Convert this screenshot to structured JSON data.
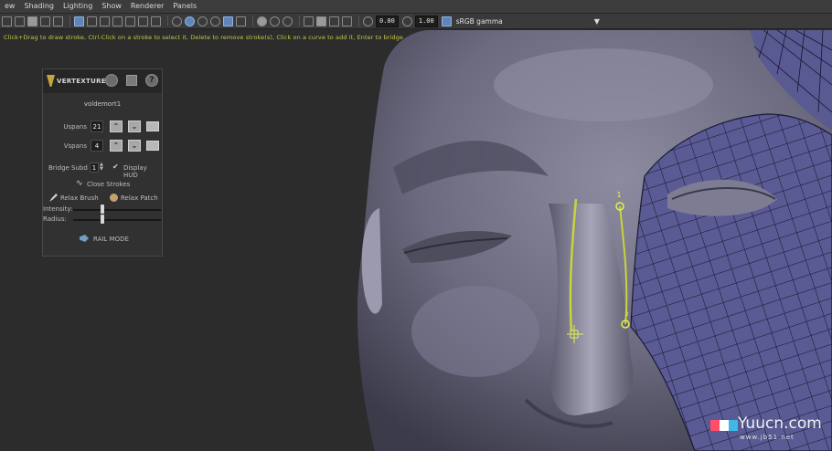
{
  "menu": [
    "ew",
    "Shading",
    "Lighting",
    "Show",
    "Renderer",
    "Panels"
  ],
  "toolbar": {
    "field_a": "0.00",
    "field_b": "1.00",
    "colorspace": "sRGB gamma",
    "dropdown_icon": "chevron-down-icon"
  },
  "hud_line": "Click+Drag to draw stroke, Ctrl-Click on a stroke to select it, Delete to remove stroke(s), Click on a curve to add it, Enter to bridge",
  "panel": {
    "title": "VERTEXTURE",
    "mesh_name": "voldemort1",
    "uspans_label": "Uspans",
    "uspans_value": "21",
    "vspans_label": "Vspans",
    "vspans_value": "4",
    "bridge_label": "Bridge Subd",
    "bridge_value": "1",
    "display_hud_label": "Display HUD",
    "close_strokes_label": "Close Strokes",
    "relax_brush_label": "Relax Brush",
    "relax_patch_label": "Relax Patch",
    "intensity_label": "Intensity:",
    "radius_label": "Radius:",
    "rail_mode_label": "RAIL MODE",
    "intensity_level": 0.33,
    "radius_level": 0.33
  },
  "viewport": {
    "stroke_label_1": "1",
    "stroke_label_2": "2"
  },
  "watermark": {
    "text": "Yuucn.com",
    "sub": "www.jb51.net",
    "colors": [
      "#ff4d6a",
      "#ffffff",
      "#3fb8e8"
    ]
  },
  "colors": {
    "skin": "#6f6e82",
    "mesh_fill": "#5a5a92",
    "stroke_yellow": "#c8d43a",
    "active_tool": "#5f86b8"
  }
}
